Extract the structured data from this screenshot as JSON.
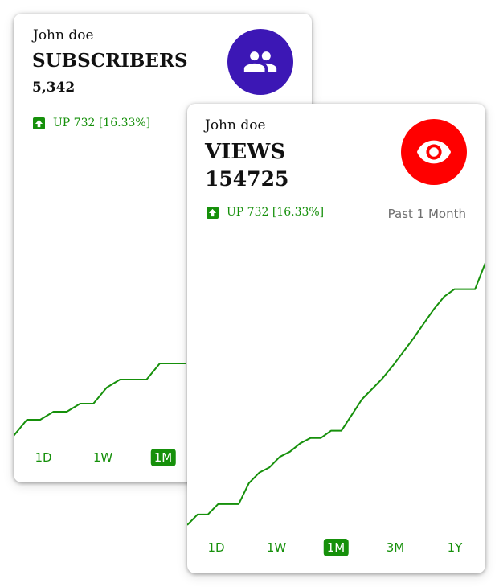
{
  "colors": {
    "accent_green": "#16900b",
    "subscribers_icon_bg": "#3c17b5",
    "views_icon_bg": "#ff0000"
  },
  "subscribers_card": {
    "owner": "John doe",
    "metric": "SUBSCRIBERS",
    "value": "5,342",
    "icon": "people-icon",
    "change_icon": "arrow-up-icon",
    "change": "UP 732 [16.33%]",
    "ranges": [
      "1D",
      "1W",
      "1M"
    ],
    "active_range": "1M",
    "chart_data": {
      "type": "line",
      "series": [
        {
          "values": [
            5,
            7,
            7,
            8,
            8,
            9,
            9,
            11,
            12,
            12,
            12,
            14,
            14,
            14
          ]
        }
      ],
      "grid": false,
      "ylim": [
        3,
        20
      ]
    }
  },
  "views_card": {
    "owner": "John doe",
    "metric": "VIEWS",
    "value": "154725",
    "icon": "eye-icon",
    "change_icon": "arrow-up-icon",
    "change": "UP 732 [16.33%]",
    "period": "Past 1 Month",
    "ranges": [
      "1D",
      "1W",
      "1M",
      "3M",
      "1Y"
    ],
    "active_range": "1M",
    "chart_data": {
      "type": "line",
      "series": [
        {
          "values": [
            2,
            3,
            3,
            4,
            4,
            4,
            6,
            7,
            7.5,
            8.5,
            9,
            9.8,
            10.3,
            10.3,
            11,
            11,
            12.5,
            14,
            15,
            16,
            17.2,
            18.5,
            19.8,
            21.2,
            22.6,
            23.8,
            24.5,
            24.5,
            24.5,
            27
          ]
        }
      ],
      "grid": false,
      "ylim": [
        0,
        28
      ]
    }
  }
}
